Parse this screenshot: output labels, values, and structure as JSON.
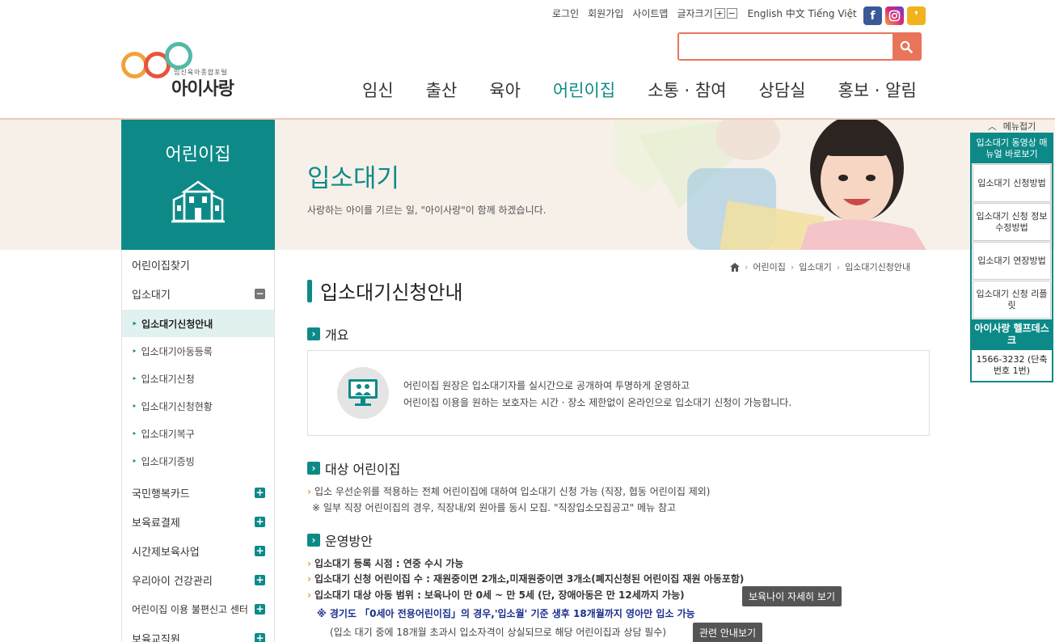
{
  "util": {
    "login": "로그인",
    "join": "회원가입",
    "sitemap": "사이트맵",
    "fontsize": "글자크기",
    "plus": "+",
    "minus": "−",
    "lang": "English 中文 Tiếng Việt"
  },
  "sns": {
    "facebook": "f",
    "kakao": "❜"
  },
  "logo": {
    "sub": "임신육아종합포털",
    "name": "아이사랑"
  },
  "gnb": [
    "임신",
    "출산",
    "육아",
    "어린이집",
    "소통 · 참여",
    "상담실",
    "홍보 · 알림"
  ],
  "visual": {
    "left_title": "어린이집",
    "title": "입소대기",
    "subtitle": "사랑하는 아이를 기르는 일, \"아이사랑\"이 함께 하겠습니다."
  },
  "quick": {
    "fold": "메뉴접기",
    "header": "입소대기 동영상 매뉴얼 바로보기",
    "items": [
      "입소대기 신청방법",
      "입소대기 신청 정보 수정방법",
      "입소대기 연장방법",
      "입소대기 신청 리플릿"
    ],
    "help_title": "아이사랑 헬프데스크",
    "tel": "1566-3232 (단축번호 1번)"
  },
  "lnb": {
    "find": "어린이집찾기",
    "waiting": "입소대기",
    "sub": [
      "입소대기신청안내",
      "입소대기아동등록",
      "입소대기신청",
      "입소대기신청현황",
      "입소대기복구",
      "입소대기증빙"
    ],
    "rest": [
      "국민행복카드",
      "보육료결제",
      "시간제보육사업",
      "우리아이 건강관리",
      "어린이집 이용 불편신고 센터",
      "보육교직원"
    ]
  },
  "breadcrumb": [
    "어린이집",
    "입소대기",
    "입소대기신청안내"
  ],
  "page_title": "입소대기신청안내",
  "overview": {
    "heading": "개요",
    "line1": "어린이집 원장은 입소대기자를 실시간으로 공개하여 투명하게 운영하고",
    "line2": "어린이집 이용을 원하는 보호자는 시간 · 장소 제한없이 온라인으로 입소대기 신청이 가능합니다."
  },
  "target": {
    "heading": "대상 어린이집",
    "line1": "입소 우선순위를 적용하는 전체 어린이집에 대하여 입소대기 신청 가능 (직장, 협동 어린이집 제외)",
    "line2": "※ 일부 직장 어린이집의 경우, 직장내/외 원아를 동시 모집. \"직장입소모집공고\" 메뉴 참고"
  },
  "operation": {
    "heading": "운영방안",
    "b1": "입소대기 등록 시점 : 연중 수시 가능",
    "b2": "입소대기 신청 어린이집 수 : 재원중이면 2개소,미재원중이면 3개소(폐지신청된 어린이집 재원 아동포함)",
    "b3": "입소대기 대상 아동 범위 : 보육나이 만 0세 ~ 만 5세 (단, 장애아동은 만 12세까지 가능)",
    "btn1": "보육나이 자세히 보기",
    "note1": "※ 경기도 「0세아 전용어린이집」의 경우,'입소월' 기준 생후 18개월까지 영아만 입소 가능",
    "note2": "(입소 대기 중에 18개월 초과시 입소자격이 상실되므로 해당 어린이집과 상담 필수)",
    "btn2": "관련 안내보기"
  },
  "colors": {
    "teal": "#0d8a88",
    "orange": "#e8745a"
  }
}
